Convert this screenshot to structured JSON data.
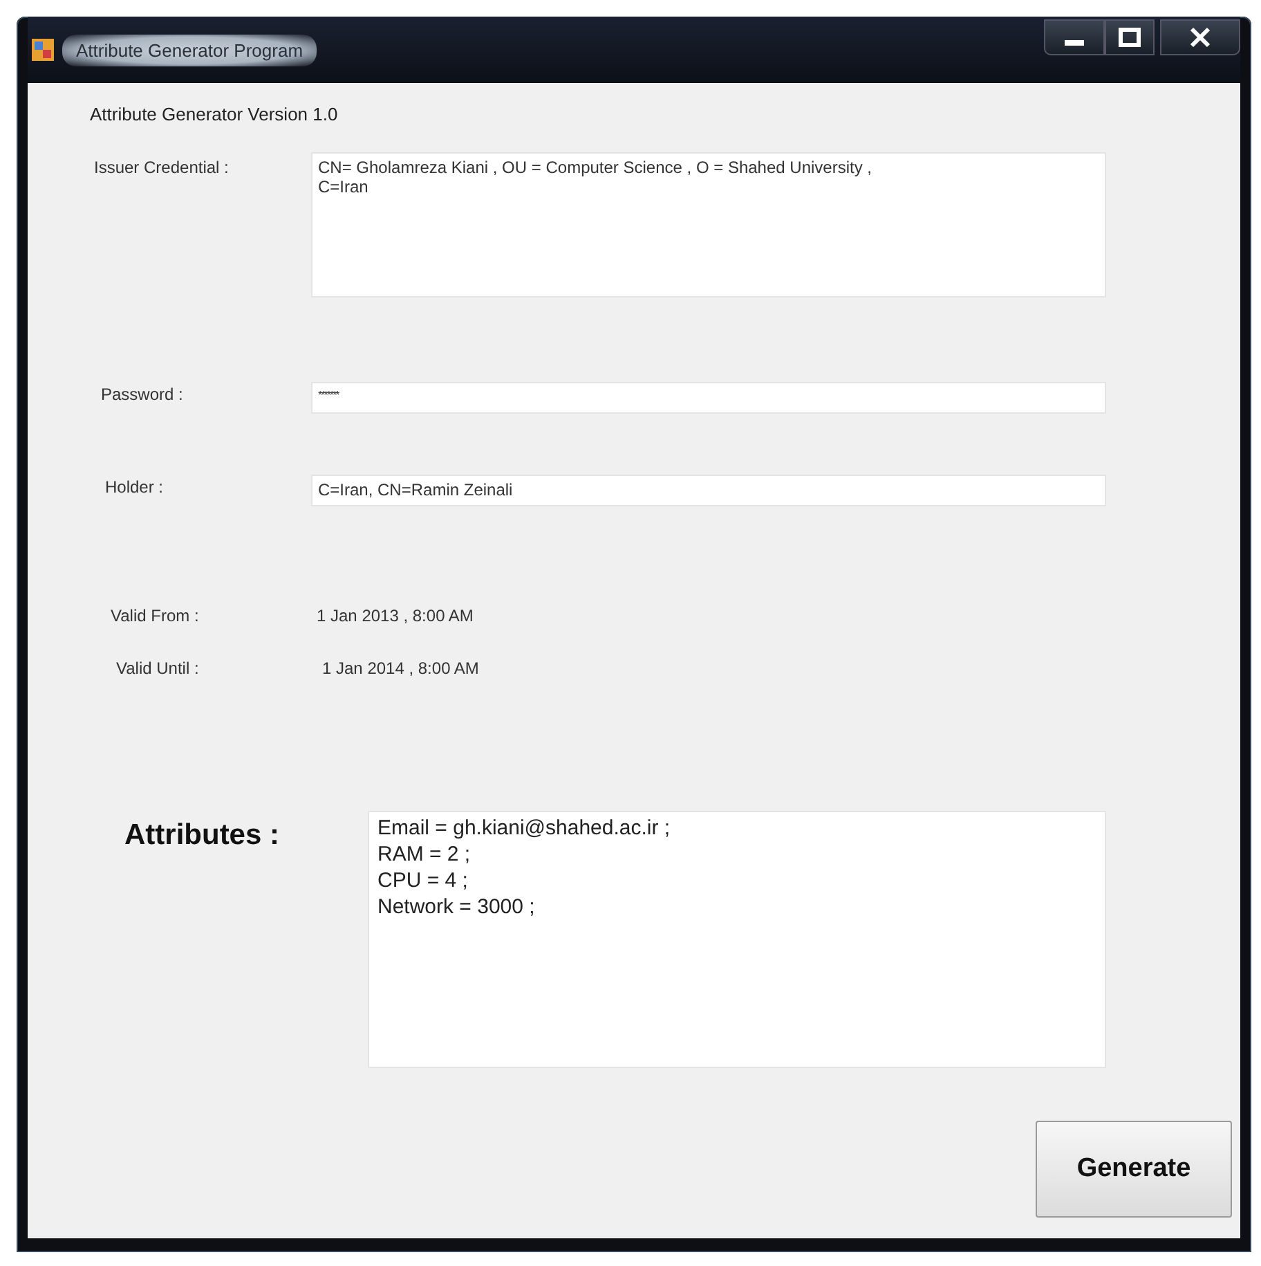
{
  "window": {
    "title": "Attribute Generator Program"
  },
  "version_label": "Attribute Generator Version 1.0",
  "fields": [
    {
      "kind": "multiline",
      "label": "Issuer Credential :",
      "value": "CN= Gholamreza Kiani , OU = Computer Science , O = Shahed University ,\nC=Iran"
    },
    {
      "kind": "password",
      "label": "Password :",
      "value": "*******"
    },
    {
      "kind": "single",
      "label": "Holder :",
      "value": "C=Iran, CN=Ramin Zeinali"
    },
    {
      "kind": "text",
      "label": "Valid From :",
      "value": "1 Jan 2013 , 8:00 AM"
    },
    {
      "kind": "text",
      "label": "Valid Until :",
      "value": "1 Jan 2014 , 8:00 AM"
    },
    {
      "kind": "attributes",
      "label": "Attributes :",
      "value": "Email = gh.kiani@shahed.ac.ir ;\nRAM = 2 ;\nCPU = 4 ;\nNetwork = 3000 ;"
    }
  ],
  "generate_button": "Generate"
}
